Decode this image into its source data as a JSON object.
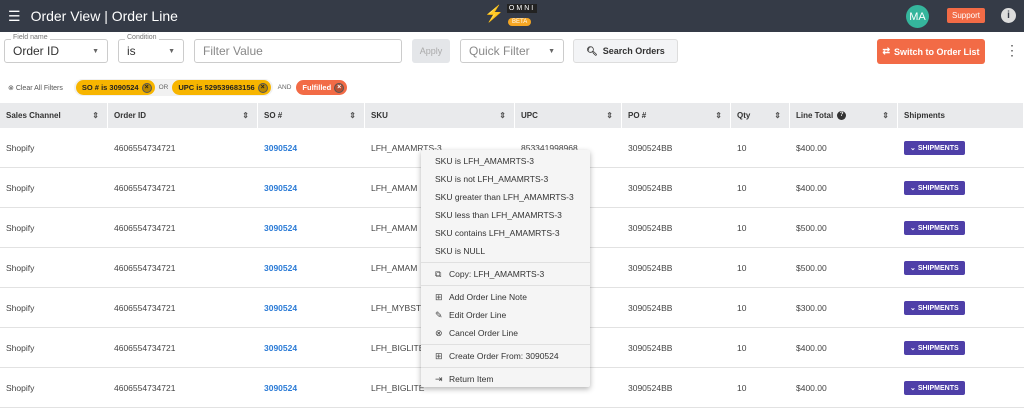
{
  "header": {
    "title": "Order View | Order Line",
    "logo_text": "OMNI",
    "logo_badge": "BETA",
    "avatar": "MA",
    "support": "Support",
    "info": "i"
  },
  "filters": {
    "field_label": "Field name",
    "field_value": "Order ID",
    "condition_label": "Condition",
    "condition_value": "is",
    "filter_value_placeholder": "Filter Value",
    "apply": "Apply",
    "quick_filter_placeholder": "Quick Filter",
    "search_orders": "Search Orders",
    "switch": "Switch to Order List"
  },
  "chips": {
    "clear": "Clear All Filters",
    "items": [
      "SO # is 3090524",
      "UPC is 529539683156",
      "Fulfilled"
    ],
    "or": "OR",
    "and": "AND"
  },
  "columns": [
    "Sales Channel",
    "Order ID",
    "SO #",
    "SKU",
    "UPC",
    "PO #",
    "Qty",
    "Line Total",
    "Shipments"
  ],
  "rows": [
    {
      "channel": "Shopify",
      "order_id": "4606554734721",
      "so": "3090524",
      "sku": "LFH_AMAMRTS-3",
      "upc": "853341998968",
      "po": "3090524BB",
      "qty": "10",
      "total": "$400.00",
      "ship": "SHIPMENTS"
    },
    {
      "channel": "Shopify",
      "order_id": "4606554734721",
      "so": "3090524",
      "sku": "LFH_AMAM",
      "upc": "",
      "po": "3090524BB",
      "qty": "10",
      "total": "$400.00",
      "ship": "SHIPMENTS"
    },
    {
      "channel": "Shopify",
      "order_id": "4606554734721",
      "so": "3090524",
      "sku": "LFH_AMAM",
      "upc": "",
      "po": "3090524BB",
      "qty": "10",
      "total": "$500.00",
      "ship": "SHIPMENTS"
    },
    {
      "channel": "Shopify",
      "order_id": "4606554734721",
      "so": "3090524",
      "sku": "LFH_AMAM",
      "upc": "",
      "po": "3090524BB",
      "qty": "10",
      "total": "$500.00",
      "ship": "SHIPMENTS"
    },
    {
      "channel": "Shopify",
      "order_id": "4606554734721",
      "so": "3090524",
      "sku": "LFH_MYBST",
      "upc": "",
      "po": "3090524BB",
      "qty": "10",
      "total": "$300.00",
      "ship": "SHIPMENTS"
    },
    {
      "channel": "Shopify",
      "order_id": "4606554734721",
      "so": "3090524",
      "sku": "LFH_BIGLITE",
      "upc": "",
      "po": "3090524BB",
      "qty": "10",
      "total": "$400.00",
      "ship": "SHIPMENTS"
    },
    {
      "channel": "Shopify",
      "order_id": "4606554734721",
      "so": "3090524",
      "sku": "LFH_BIGLITE",
      "upc": "",
      "po": "3090524BB",
      "qty": "10",
      "total": "$400.00",
      "ship": "SHIPMENTS"
    }
  ],
  "context_menu": {
    "filters": [
      "SKU is LFH_AMAMRTS-3",
      "SKU is not LFH_AMAMRTS-3",
      "SKU greater than LFH_AMAMRTS-3",
      "SKU less than LFH_AMAMRTS-3",
      "SKU contains LFH_AMAMRTS-3",
      "SKU is NULL"
    ],
    "copy": "Copy: LFH_AMAMRTS-3",
    "actions": [
      "Add Order Line Note",
      "Edit Order Line",
      "Cancel Order Line"
    ],
    "create": "Create Order From: 3090524",
    "return": "Return Item"
  }
}
